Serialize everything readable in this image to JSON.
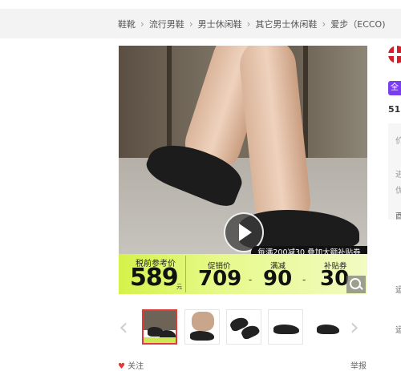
{
  "breadcrumb": {
    "items": [
      "鞋靴",
      "流行男鞋",
      "男士休闲鞋",
      "其它男士休闲鞋",
      "爱步（ECCO)"
    ],
    "separator": "›"
  },
  "product_image": {
    "promo_banner": "每满200减30 叠加大额补贴券",
    "reference_price_label": "税前参考价",
    "reference_price": "589",
    "reference_price_unit": "元",
    "promo_price_label": "促销价",
    "promo_price": "709",
    "discount_label": "满减",
    "discount_value": "90",
    "subsidy_label": "补贴券",
    "subsidy_value": "30",
    "minus_sign": "-",
    "accent_color": "#d4f24a"
  },
  "thumbnails": {
    "prev_icon": "‹",
    "next_icon": "›",
    "count": 5,
    "active_index": 0
  },
  "footer": {
    "follow_label": "关注",
    "report_label": "举报"
  },
  "right_panel": {
    "badge_text": "全",
    "number_text": "51",
    "lines": [
      "价",
      "进",
      "优",
      "酉",
      "运",
      "运"
    ]
  },
  "colors": {
    "accent_red": "#e4393c",
    "badge_purple": "#7a3ef0"
  }
}
